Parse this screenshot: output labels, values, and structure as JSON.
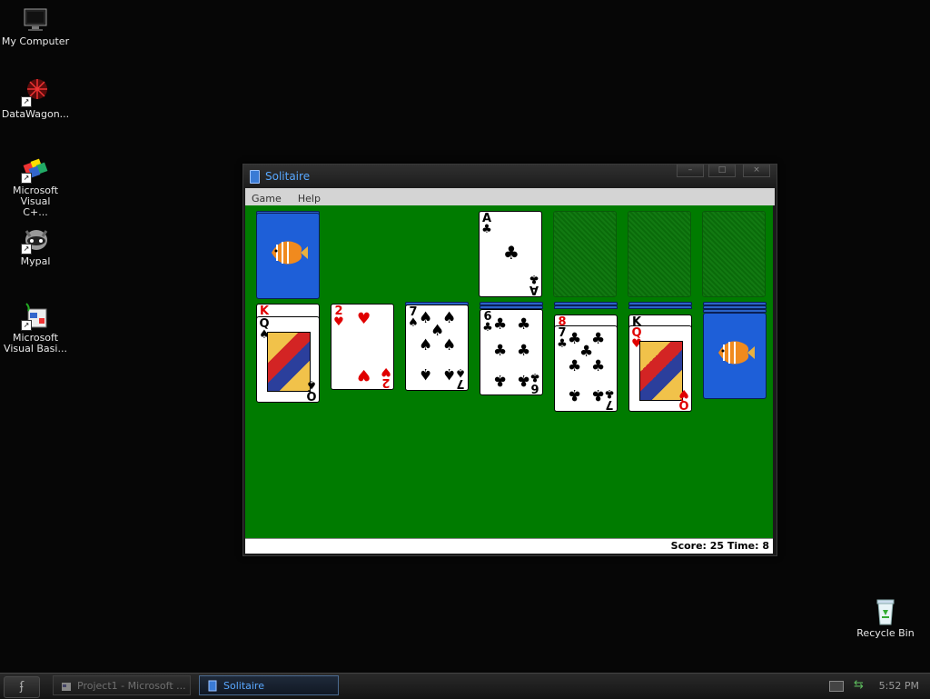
{
  "desktop": {
    "icons": [
      {
        "label": "My Computer",
        "icon": "monitor-icon"
      },
      {
        "label": "DataWagon...",
        "icon": "datawagon-icon"
      },
      {
        "label": "Microsoft Visual C+...",
        "icon": "visual-cpp-icon"
      },
      {
        "label": "Mypal",
        "icon": "mypal-icon"
      },
      {
        "label": "Microsoft Visual Basi...",
        "icon": "visual-basic-icon"
      },
      {
        "label": "Recycle Bin",
        "icon": "recycle-bin-icon"
      }
    ]
  },
  "window": {
    "title": "Solitaire",
    "controls": {
      "minimize": "–",
      "maximize": "□",
      "close": "×"
    },
    "menu": [
      "Game",
      "Help"
    ],
    "status": "Score: 25 Time: 8",
    "colors": {
      "felt": "#007b00",
      "title": "#58a8ff",
      "card_back": "#1e5fd8"
    }
  },
  "cards": {
    "foundation_ace": {
      "rank": "A",
      "suit": "♣"
    },
    "tableau": [
      {
        "rank": "Q",
        "suit": "♠",
        "behind": "K"
      },
      {
        "rank": "2",
        "suit": "♥"
      },
      {
        "rank": "7",
        "suit": "♠"
      },
      {
        "rank": "6",
        "suit": "♣"
      },
      {
        "rank": "7",
        "suit": "♣",
        "behind": "8"
      },
      {
        "rank": "Q",
        "suit": "♥",
        "behind": "K"
      }
    ]
  },
  "taskbar": {
    "start": "ʄ",
    "items": [
      {
        "label": "Project1 - Microsoft ...",
        "active": false
      },
      {
        "label": "Solitaire",
        "active": true
      }
    ],
    "clock": "5:52 PM"
  }
}
